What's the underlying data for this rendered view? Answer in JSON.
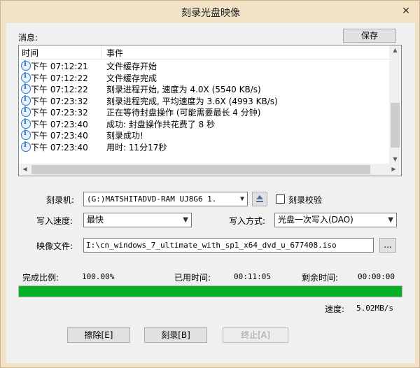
{
  "window": {
    "title": "刻录光盘映像",
    "close_glyph": "✕"
  },
  "messages": {
    "label": "消息:",
    "save_label": "保存",
    "columns": {
      "time": "时间",
      "event": "事件"
    },
    "rows": [
      {
        "time": "下午 07:12:21",
        "event": "文件缓存开始"
      },
      {
        "time": "下午 07:12:22",
        "event": "文件缓存完成"
      },
      {
        "time": "下午 07:12:22",
        "event": "刻录进程开始, 速度为 4.0X (5540 KB/s)"
      },
      {
        "time": "下午 07:23:32",
        "event": "刻录进程完成, 平均速度为 3.6X (4993 KB/s)"
      },
      {
        "time": "下午 07:23:32",
        "event": "正在等待封盘操作 (可能需要最长 4 分钟)"
      },
      {
        "time": "下午 07:23:40",
        "event": "成功: 封盘操作共花费了 8 秒"
      },
      {
        "time": "下午 07:23:40",
        "event": "刻录成功!"
      },
      {
        "time": "下午 07:23:40",
        "event": "用时: 11分17秒"
      }
    ]
  },
  "settings": {
    "recorder_label": "刻录机:",
    "recorder_value": "(G:)MATSHITADVD-RAM UJ8G6   1.",
    "verify_label": "刻录校验",
    "verify_checked": false,
    "speed_label": "写入速度:",
    "speed_value": "最快",
    "mode_label": "写入方式:",
    "mode_value": "光盘一次写入(DAO)",
    "image_label": "映像文件:",
    "image_value": "I:\\cn_windows_7_ultimate_with_sp1_x64_dvd_u_677408.iso",
    "browse_label": "..."
  },
  "status": {
    "progress_label": "完成比例:",
    "progress_value": "100.00%",
    "progress_fraction": 1.0,
    "elapsed_label": "已用时间:",
    "elapsed_value": "00:11:05",
    "remaining_label": "剩余时间:",
    "remaining_value": "00:00:00",
    "speed_label": "速度:",
    "speed_value": "5.02MB/s"
  },
  "buttons": {
    "erase": "擦除[E]",
    "burn": "刻录[B]",
    "stop": "终止[A]"
  },
  "colors": {
    "progress_fill": "#06b025",
    "frame": "#f3e3c6",
    "info_icon": "#2a6fc2"
  }
}
